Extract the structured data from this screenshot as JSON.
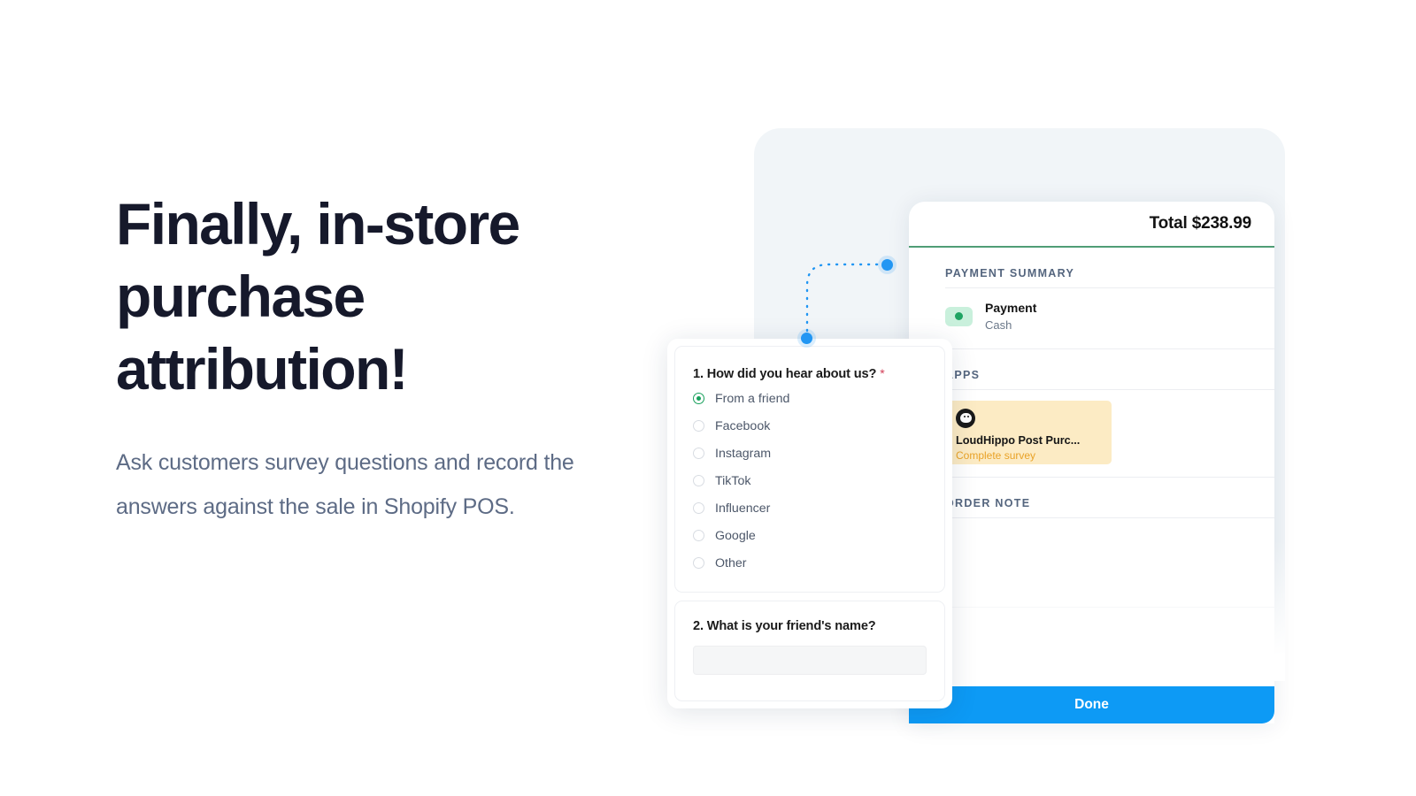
{
  "hero": {
    "headline": "Finally, in-store purchase attribution!",
    "subcopy": "Ask customers survey questions and record the answers against the sale in Shopify POS."
  },
  "colors": {
    "headline": "#16192b",
    "subcopy": "#5d6b85",
    "accent_blue": "#0d9af5",
    "connector_blue": "#2196f3",
    "total_rule_green": "#4f9d76",
    "radio_selected_green": "#18a05c",
    "app_card_bg": "#fcebc4",
    "app_action_orange": "#e9a227",
    "payment_badge_bg": "#c9f0dc",
    "payment_dot_green": "#1fa463",
    "backdrop": "#f1f5f8"
  },
  "pos": {
    "total_label": "Total $238.99",
    "payment_summary_heading": "PAYMENT SUMMARY",
    "payment": {
      "title": "Payment",
      "method": "Cash",
      "status_icon": "green-dot-icon"
    },
    "apps_heading": "APPS",
    "app": {
      "logo_icon": "loudhippo-logo-icon",
      "name": "LoudHippo Post Purc...",
      "action": "Complete survey"
    },
    "order_note_heading": "ORDER NOTE",
    "done_label": "Done"
  },
  "survey": {
    "questions": [
      {
        "title": "1. How did you hear about us?",
        "required_marker": "*",
        "type": "radio",
        "selected_index": 0,
        "options": [
          "From a friend",
          "Facebook",
          "Instagram",
          "TikTok",
          "Influencer",
          "Google",
          "Other"
        ]
      },
      {
        "title": "2. What is your friend's name?",
        "type": "text",
        "value": "",
        "placeholder": ""
      }
    ]
  }
}
